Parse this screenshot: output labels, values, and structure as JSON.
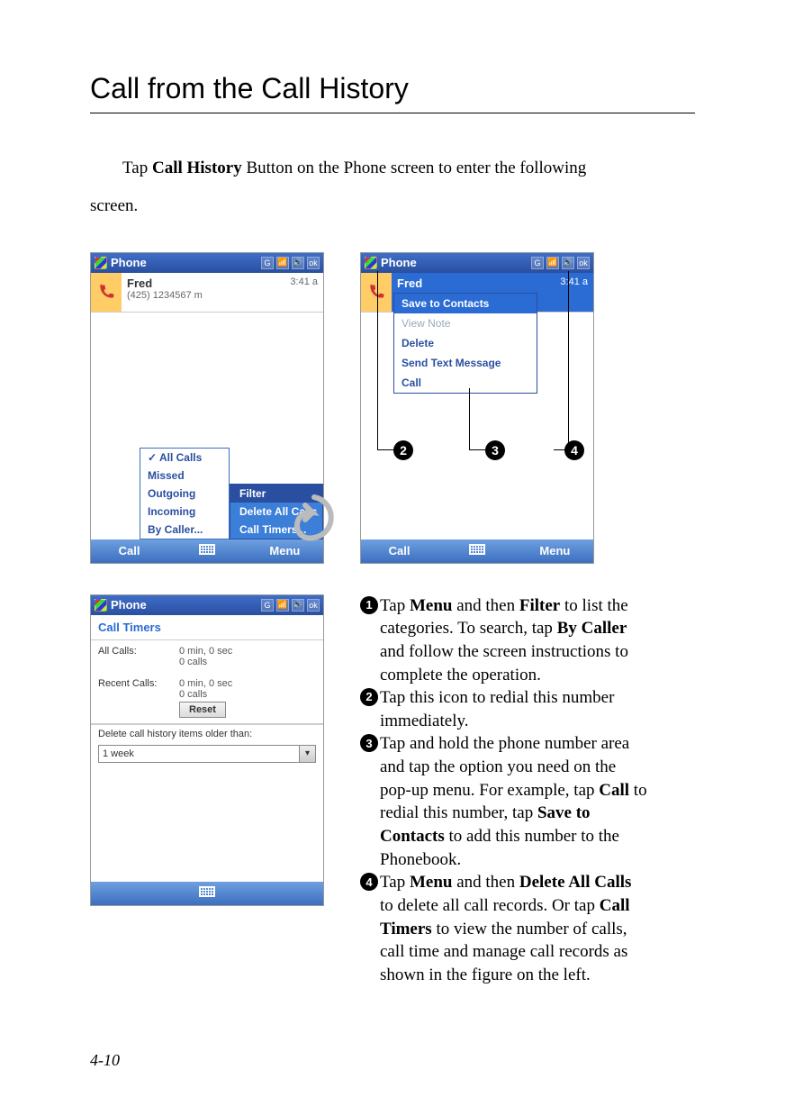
{
  "heading": "Call from the Call History",
  "intro_l1": "Tap ",
  "intro_b1": "Call History",
  "intro_l2": " Button on the Phone screen to enter the following",
  "intro_l3": "screen.",
  "page_number": "4-10",
  "phone1": {
    "title": "Phone",
    "ok": "ok",
    "contact_name": "Fred",
    "contact_number": "(425) 1234567 m",
    "time": "3:41 a",
    "filter_menu": [
      "All Calls",
      "Missed",
      "Outgoing",
      "Incoming",
      "By Caller..."
    ],
    "sub_menu": [
      "Filter",
      "Delete All Calls",
      "Call Timers..."
    ],
    "bottom_left": "Call",
    "bottom_right": "Menu"
  },
  "callout1": "1",
  "phone2": {
    "title": "Phone",
    "ok": "ok",
    "contact_name": "Fred",
    "time": "3:41 a",
    "ctx": [
      "Save to Contacts",
      "View Note",
      "Delete",
      "Send Text Message",
      "Call"
    ],
    "bottom_left": "Call",
    "bottom_right": "Menu"
  },
  "callouts234": [
    "2",
    "3",
    "4"
  ],
  "phone3": {
    "title": "Phone",
    "ok": "ok",
    "header": "Call Timers",
    "row1_label": "All Calls:",
    "row1_v1": "0 min, 0 sec",
    "row1_v2": "0 calls",
    "row2_label": "Recent Calls:",
    "row2_v1": "0 min, 0 sec",
    "row2_v2": "0 calls",
    "reset": "Reset",
    "older": "Delete call history items older than:",
    "combo": "1 week"
  },
  "instr": {
    "i1a": "Tap ",
    "i1b1": "Menu",
    "i1c": " and then ",
    "i1b2": "Filter",
    "i1d": " to list the categories. To search, tap ",
    "i1b3": "By Caller",
    "i1e": " and follow the screen instructions to complete the operation.",
    "i2": "Tap this icon to redial this number immediately.",
    "i3a": "Tap and hold the phone number area and tap the option you need on the pop-up menu. For example, tap ",
    "i3b1": "Call",
    "i3b": " to redial this number, tap ",
    "i3b2": "Save to Contacts",
    "i3c": " to add this number to the Phonebook.",
    "i4a": "Tap ",
    "i4b1": "Menu",
    "i4b": " and then ",
    "i4b2": "Delete All Calls",
    "i4c": " to delete all call records. Or tap ",
    "i4b3": "Call Timers",
    "i4d": " to view the number of calls, call time and manage call records as shown in the figure on the left."
  }
}
